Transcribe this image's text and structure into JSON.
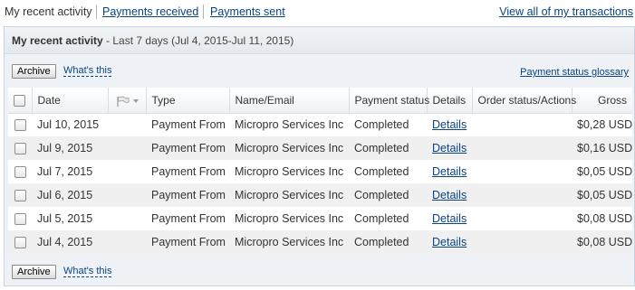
{
  "nav": {
    "current": "My recent activity",
    "payments_received": "Payments received",
    "payments_sent": "Payments sent",
    "view_all": "View all of my transactions"
  },
  "panel": {
    "title": "My recent activity",
    "range": " - Last 7 days (Jul 4, 2015-Jul 11, 2015)"
  },
  "toolbar": {
    "archive_label": "Archive",
    "whats_this": "What's this",
    "glossary": "Payment status glossary"
  },
  "table": {
    "columns": {
      "date": "Date",
      "type": "Type",
      "name": "Name/Email",
      "status": "Payment status",
      "details": "Details",
      "order": "Order status/Actions",
      "gross": "Gross"
    },
    "rows": [
      {
        "date": "Jul 10, 2015",
        "type": "Payment From",
        "name": "Micropro Services Inc",
        "status": "Completed",
        "details": "Details",
        "gross": "$0,28 USD"
      },
      {
        "date": "Jul 9, 2015",
        "type": "Payment From",
        "name": "Micropro Services Inc",
        "status": "Completed",
        "details": "Details",
        "gross": "$0,16 USD"
      },
      {
        "date": "Jul 7, 2015",
        "type": "Payment From",
        "name": "Micropro Services Inc",
        "status": "Completed",
        "details": "Details",
        "gross": "$0,05 USD"
      },
      {
        "date": "Jul 6, 2015",
        "type": "Payment From",
        "name": "Micropro Services Inc",
        "status": "Completed",
        "details": "Details",
        "gross": "$0,05 USD"
      },
      {
        "date": "Jul 5, 2015",
        "type": "Payment From",
        "name": "Micropro Services Inc",
        "status": "Completed",
        "details": "Details",
        "gross": "$0,08 USD"
      },
      {
        "date": "Jul 4, 2015",
        "type": "Payment From",
        "name": "Micropro Services Inc",
        "status": "Completed",
        "details": "Details",
        "gross": "$0,08 USD"
      }
    ]
  },
  "bottom": {
    "archive_label": "Archive",
    "whats_this": "What's this"
  },
  "icons": {
    "flag_column": "flag-icon",
    "flag_menu": "chevron-down-icon",
    "select_all": "checkbox"
  },
  "colors": {
    "link": "#084482",
    "panel_bg": "#eef2f6",
    "row_alt": "#f0f0f0"
  }
}
